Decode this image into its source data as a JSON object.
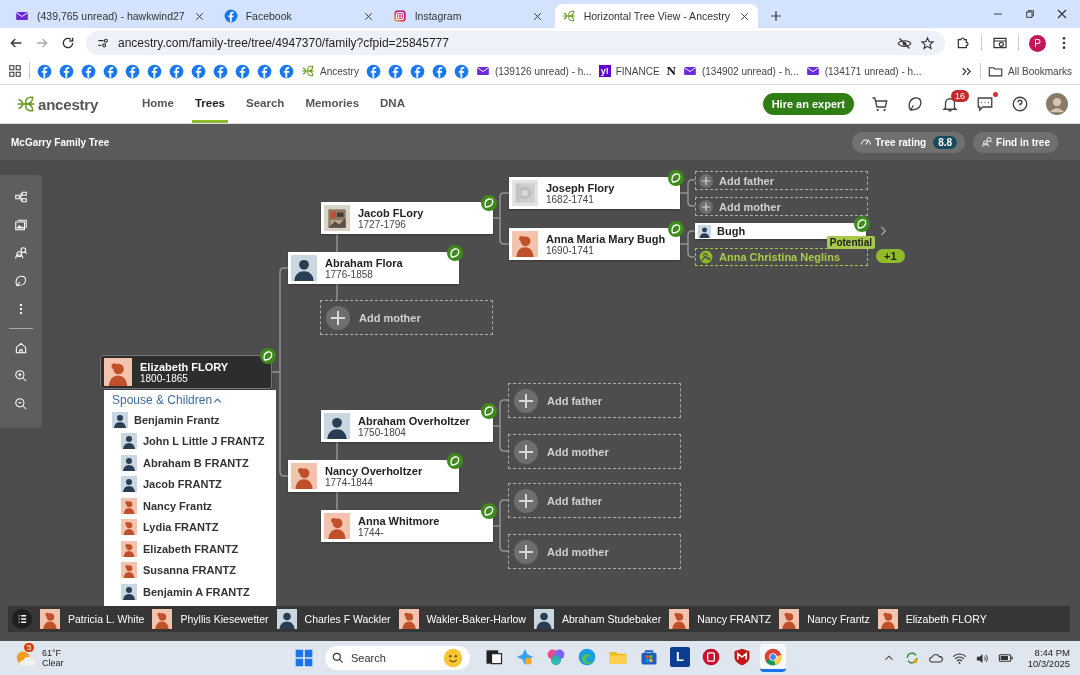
{
  "browser": {
    "tabs": [
      {
        "title": "(439,765 unread) - hawkwind27",
        "kind": "mail",
        "selected": false
      },
      {
        "title": "Facebook",
        "kind": "facebook",
        "selected": false
      },
      {
        "title": "Instagram",
        "kind": "instagram",
        "selected": false
      },
      {
        "title": "Horizontal Tree View - Ancestry",
        "kind": "ancestry",
        "selected": true
      }
    ],
    "url": "ancestry.com/family-tree/tree/4947370/family?cfpid=25845777",
    "profile": "P",
    "bookmarks": [
      {
        "kind": "facebook"
      },
      {
        "kind": "facebook"
      },
      {
        "kind": "facebook"
      },
      {
        "kind": "facebook"
      },
      {
        "kind": "facebook"
      },
      {
        "kind": "facebook"
      },
      {
        "kind": "facebook"
      },
      {
        "kind": "facebook"
      },
      {
        "kind": "facebook"
      },
      {
        "kind": "facebook"
      },
      {
        "kind": "facebook"
      },
      {
        "kind": "facebook"
      },
      {
        "kind": "ancestry",
        "label": "Ancestry"
      },
      {
        "kind": "facebook"
      },
      {
        "kind": "facebook"
      },
      {
        "kind": "facebook"
      },
      {
        "kind": "facebook"
      },
      {
        "kind": "facebook"
      },
      {
        "kind": "mail",
        "label": "(139126 unread) - h..."
      },
      {
        "kind": "finance",
        "glyph": "y!",
        "label": "FINANCE"
      },
      {
        "kind": "news",
        "glyph": "N"
      },
      {
        "kind": "mail",
        "label": "(134902 unread) - h..."
      },
      {
        "kind": "mail",
        "label": "(134171 unread) - h..."
      }
    ],
    "all_bookmarks": "All Bookmarks"
  },
  "site": {
    "logo": "ancestry",
    "nav": [
      {
        "label": "Home",
        "selected": false
      },
      {
        "label": "Trees",
        "selected": true
      },
      {
        "label": "Search",
        "selected": false
      },
      {
        "label": "Memories",
        "selected": false
      },
      {
        "label": "DNA",
        "selected": false
      }
    ],
    "hire": "Hire an expert",
    "notifications": "16",
    "messages_unread": true,
    "tree_name": "McGarry Family Tree",
    "rating_label": "Tree rating",
    "rating": "8.8",
    "find": "Find in tree"
  },
  "tree": {
    "nodes": [
      {
        "kind": "person",
        "name": "Joseph Flory",
        "dates": "1682-1741",
        "avatar": {
          "kind": "document"
        },
        "hint": true
      },
      {
        "kind": "add-compact",
        "label": "Add father",
        "hint": false
      },
      {
        "kind": "add-compact",
        "label": "Add mother",
        "hint": false
      },
      {
        "kind": "person",
        "name": "Jacob FLory",
        "dates": "1727-1796",
        "hint": true
      },
      {
        "kind": "person-compact",
        "name": "Bugh",
        "avatar": {
          "kind": "male"
        },
        "hint": true
      },
      {
        "kind": "person",
        "name": "Anna Maria Mary Bugh",
        "dates": "1690-1741",
        "avatar": {
          "kind": "female"
        },
        "hint": true
      },
      {
        "kind": "potential",
        "name": "Anna Christina Neglins",
        "tag": "Potential",
        "more": "+1",
        "hint": false
      },
      {
        "kind": "person",
        "name": "Abraham Flora",
        "dates": "1776-1858",
        "avatar": {
          "kind": "male"
        },
        "hint": true
      },
      {
        "kind": "add",
        "label": "Add mother",
        "hint": false
      },
      {
        "kind": "focus",
        "name": "Elizabeth FLORY",
        "dates": "1800-1865",
        "avatar": {
          "kind": "female"
        },
        "hint": true,
        "family": {
          "heading": "Spouse & Children",
          "expanded": true,
          "spouses": [
            {
              "name": "Benjamin Frantz",
              "kind": "male",
              "children": [
                {
                  "name": "John L Little J FRANTZ",
                  "kind": "male"
                },
                {
                  "name": "Abraham B FRANTZ",
                  "kind": "male"
                },
                {
                  "name": "Jacob FRANTZ",
                  "kind": "male"
                },
                {
                  "name": "Nancy Frantz",
                  "kind": "female"
                },
                {
                  "name": "Lydia FRANTZ",
                  "kind": "female"
                },
                {
                  "name": "Elizabeth FRANTZ",
                  "kind": "female"
                },
                {
                  "name": "Susanna FRANTZ",
                  "kind": "female"
                },
                {
                  "name": "Benjamin A FRANTZ",
                  "kind": "male"
                }
              ]
            }
          ]
        }
      },
      {
        "kind": "add",
        "label": "Add father",
        "hint": false
      },
      {
        "kind": "person",
        "name": "Abraham Overholtzer",
        "dates": "1750-1804",
        "avatar": {
          "kind": "male"
        },
        "hint": true
      },
      {
        "kind": "add",
        "label": "Add mother",
        "hint": false
      },
      {
        "kind": "person",
        "name": "Nancy Overholtzer",
        "dates": "1774-1844",
        "avatar": {
          "kind": "female"
        },
        "hint": true
      },
      {
        "kind": "add",
        "label": "Add father",
        "hint": false
      },
      {
        "kind": "person",
        "name": "Anna Whitmore",
        "dates": "1744-",
        "avatar": {
          "kind": "female"
        },
        "hint": true
      },
      {
        "kind": "add",
        "label": "Add mother",
        "hint": false
      }
    ],
    "recent": [
      {
        "name": "Patricia L. White",
        "kind": "female"
      },
      {
        "name": "Phyllis Kiesewetter",
        "kind": "female"
      },
      {
        "name": "Charles F Wackler",
        "kind": "male"
      },
      {
        "name": "Wakler-Baker-Harlow",
        "kind": "female"
      },
      {
        "name": "Abraham Studebaker",
        "kind": "male"
      },
      {
        "name": "Nancy FRANTZ",
        "kind": "female"
      },
      {
        "name": "Nancy Frantz",
        "kind": "female"
      },
      {
        "name": "Elizabeth FLORY",
        "kind": "female"
      }
    ]
  },
  "taskbar": {
    "weather": {
      "alerts": "5",
      "temp": "61°F",
      "sky": "Clear"
    },
    "search": {
      "placeholder": "Search"
    },
    "apps": [
      {
        "kind": "task-view",
        "selected": false
      },
      {
        "kind": "copilot",
        "selected": false
      },
      {
        "kind": "m365",
        "selected": false
      },
      {
        "kind": "edge",
        "selected": false
      },
      {
        "kind": "folder",
        "selected": false
      },
      {
        "kind": "store",
        "selected": false
      },
      {
        "kind": "letter",
        "glyph": "L",
        "selected": false
      },
      {
        "kind": "record-app",
        "selected": false
      },
      {
        "kind": "shield",
        "selected": false
      },
      {
        "kind": "chrome",
        "selected": true
      }
    ],
    "time": "8:44 PM",
    "date": "10/3/2025"
  }
}
